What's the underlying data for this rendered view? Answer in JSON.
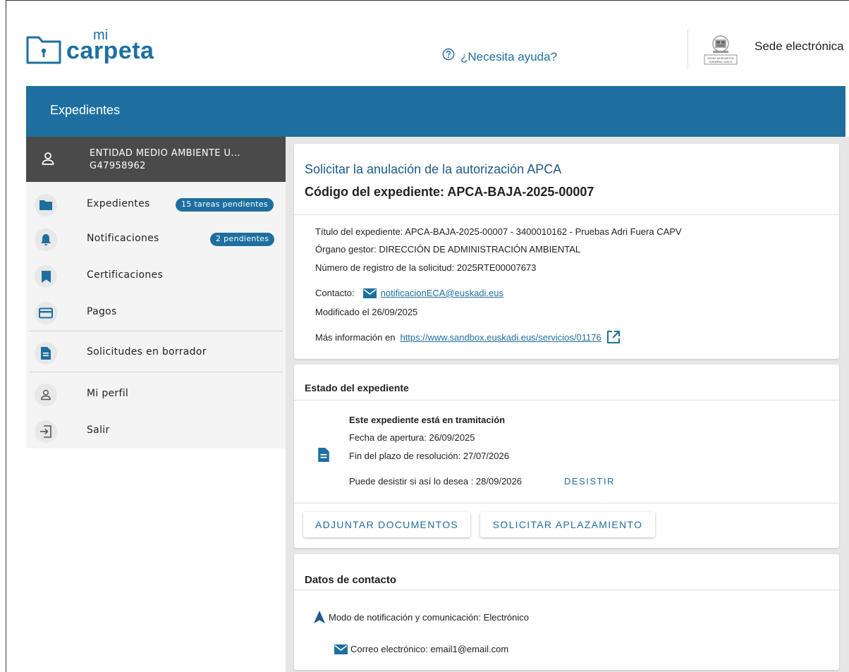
{
  "header": {
    "logo_small": "mi",
    "logo_main": "carpeta",
    "help_label": "¿Necesita ayuda?",
    "sede_label": "Sede electrónica",
    "gv_logo_line1": "EUSKO JAURLARITZA",
    "gv_logo_line2": "GOBIERNO VASCO"
  },
  "bluebar": {
    "title": "Expedientes"
  },
  "sidebar": {
    "entity_name": "ENTIDAD MEDIO AMBIENTE U...",
    "entity_id": "G47958962",
    "items": [
      {
        "label": "Expedientes",
        "badge": "15 tareas pendientes",
        "icon": "folder-icon"
      },
      {
        "label": "Notificaciones",
        "badge": "2 pendientes",
        "icon": "bell-icon"
      },
      {
        "label": "Certificaciones",
        "icon": "bookmark-icon"
      },
      {
        "label": "Pagos",
        "icon": "card-icon"
      },
      {
        "label": "Solicitudes en borrador",
        "icon": "document-icon"
      },
      {
        "label": "Mi perfil",
        "icon": "user-icon"
      },
      {
        "label": "Salir",
        "icon": "logout-icon"
      }
    ]
  },
  "expediente": {
    "title": "Solicitar la anulación de la autorización APCA",
    "code_line": "Código del expediente: APCA-BAJA-2025-00007",
    "titulo_line": "Título del expediente: APCA-BAJA-2025-00007 - 3400010162 - Pruebas Adri Fuera CAPV",
    "organo_line": "Órgano gestor: DIRECCIÓN DE ADMINISTRACIÓN AMBIENTAL",
    "registro_line": "Número de registro de la solicitud: 2025RTE00007673",
    "contacto_label": "Contacto:",
    "contacto_email": "notificacionECA@euskadi.eus",
    "modificado_line": "Modificado el 26/09/2025",
    "mas_info_label": "Más información en",
    "mas_info_url": "https://www.sandbox.euskadi.eus/servicios/01176"
  },
  "estado": {
    "section_title": "Estado del expediente",
    "status": "Este expediente está en tramitación",
    "apertura": "Fecha de apertura: 26/09/2025",
    "fin_plazo": "Fin del plazo de resolución: 27/07/2026",
    "desistir_text": "Puede desistir si así lo desea : 28/09/2026",
    "desistir_action": "DESISTIR",
    "btn_adjuntar": "ADJUNTAR DOCUMENTOS",
    "btn_aplazamiento": "SOLICITAR APLAZAMIENTO"
  },
  "contacto": {
    "section_title": "Datos de contacto",
    "modo": "Modo de notificación y comunicación: Electrónico",
    "correo": "Correo electrónico: email1@email.com"
  },
  "colors": {
    "brand_blue": "#1e6fa0",
    "entity_bg": "#4a4a4a",
    "sidebar_bg": "#f4f4f4",
    "content_bg": "#e6e6e6"
  }
}
